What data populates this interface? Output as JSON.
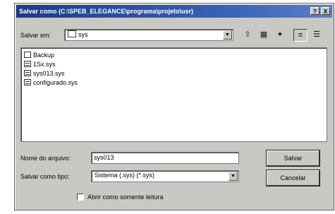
{
  "window": {
    "title": "Salvar como (C:\\SPEB_ELEGANCE\\programa\\projeto\\usr)",
    "help_label": "?",
    "close_label": "X"
  },
  "toolbar": {
    "look_in_label": "Salvar em:",
    "look_in_value": "sys",
    "buttons": [
      {
        "name": "up-folder-icon",
        "glyph": "⇧"
      },
      {
        "name": "desktop-icon",
        "glyph": "▦"
      },
      {
        "name": "new-folder-icon",
        "glyph": "✦"
      },
      {
        "name": "list-view-icon",
        "glyph": "≡"
      },
      {
        "name": "details-view-icon",
        "glyph": "☰"
      }
    ]
  },
  "files": [
    {
      "name": "Backup",
      "type": "folder"
    },
    {
      "name": "1Sx.sys",
      "type": "file"
    },
    {
      "name": "sys013.sys",
      "type": "file"
    },
    {
      "name": "configurado.sys",
      "type": "file"
    }
  ],
  "form": {
    "filename_label": "Nome do arquivo:",
    "filename_value": "sys013",
    "filetype_label": "Salvar como tipo:",
    "filetype_value": "Sistema (.sys) (*.sys)",
    "readonly_label": "Abrir como somente leitura",
    "save_button": "Salvar",
    "cancel_button": "Cancelar"
  }
}
